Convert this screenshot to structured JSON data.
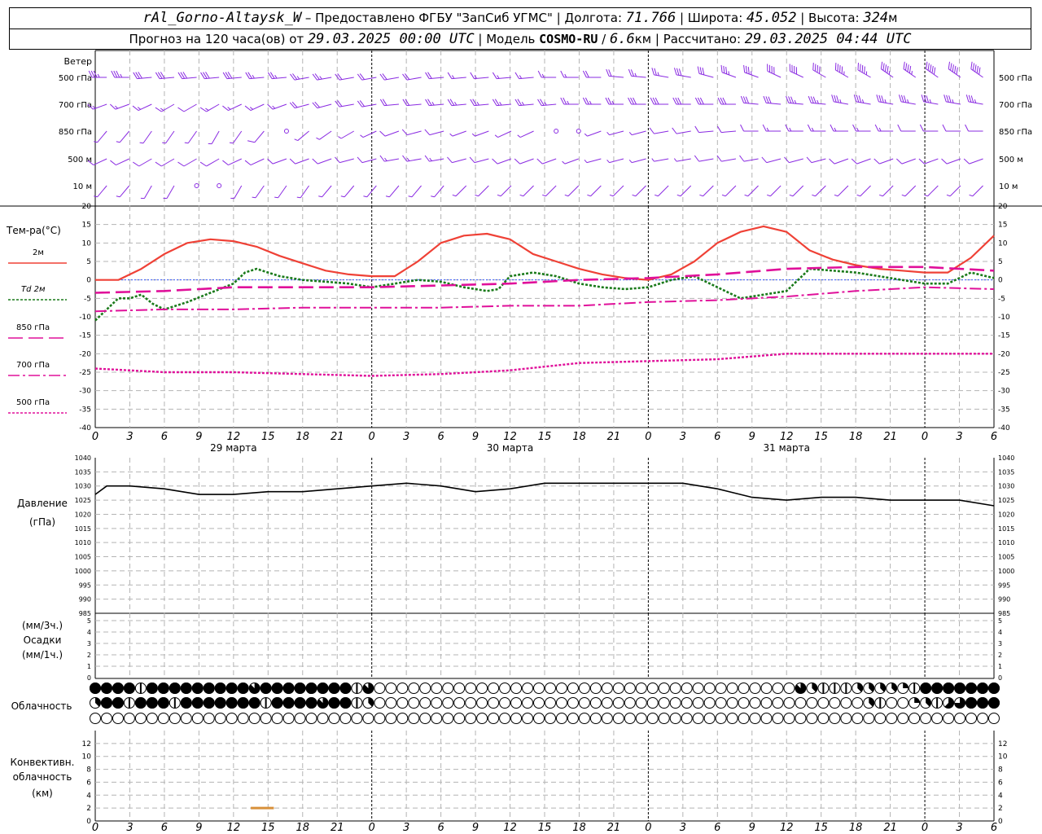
{
  "header": {
    "station": "rAl_Gorno-Altaysk_W",
    "provider": " – Предоставлено ФГБУ \"ЗапСиб УГМС\" | Долгота: ",
    "lon": "71.766",
    "lat_label": " | Широта: ",
    "lat": "45.052",
    "alt_label": " | Высота: ",
    "alt": "324",
    "alt_unit": "м",
    "line2_a": "Прогноз на 120 часа(ов) от ",
    "run": "29.03.2025 00:00 UTC",
    "line2_b": " | Модель ",
    "model": "COSMO-RU",
    "model_sep": " / ",
    "res": "6.6",
    "res_unit": "км",
    "line2_c": " | Рассчитано: ",
    "calc": "29.03.2025 04:44 UTC"
  },
  "labels": {
    "wind_title": "Ветер",
    "wind_levels": [
      "500 гПа",
      "700 гПа",
      "850 гПа",
      "500 м",
      "10 м"
    ],
    "temp_title": "Тем-ра(°С)",
    "temp_legend": [
      "2м",
      "Td 2м",
      "850 гПа",
      "700 гПа",
      "500 гПа"
    ],
    "pressure_title": "Давление",
    "pressure_unit": "(гПа)",
    "precip_top": "(мм/3ч.)",
    "precip_title": "Осадки",
    "precip_bottom": "(мм/1ч.)",
    "cloud_title": "Облачность",
    "conv_1": "Конвективн.",
    "conv_2": "облачность",
    "conv_3": "(км)"
  },
  "colors": {
    "wind": "#8a2be2",
    "t2m": "#ef4136",
    "td": "#1a7a1a",
    "t850": "#e0109a",
    "zero_line": "#3355ff",
    "pressure": "#000000",
    "conv": "#d8903a"
  },
  "chart_data": {
    "type": "line",
    "x_ticks": [
      "0",
      "3",
      "6",
      "9",
      "12",
      "15",
      "18",
      "21",
      "0",
      "3",
      "6",
      "9",
      "12",
      "15",
      "18",
      "21",
      "0",
      "3",
      "6",
      "9",
      "12",
      "15",
      "18",
      "21",
      "0",
      "3",
      "6"
    ],
    "dates": [
      "29 марта",
      "30 марта",
      "31 марта"
    ],
    "x_hours_range": [
      0,
      78
    ],
    "temperature": {
      "ylim": [
        -40,
        20
      ],
      "yticks": [
        20,
        15,
        10,
        5,
        0,
        -5,
        -10,
        -15,
        -20,
        -25,
        -30,
        -35,
        -40
      ],
      "series": [
        {
          "name": "2м",
          "x": [
            0,
            2,
            4,
            6,
            8,
            10,
            12,
            14,
            16,
            18,
            20,
            22,
            24,
            26,
            28,
            30,
            32,
            34,
            36,
            38,
            40,
            42,
            44,
            46,
            48,
            50,
            52,
            54,
            56,
            58,
            60,
            62,
            64,
            66,
            68,
            70,
            72,
            74,
            76,
            78
          ],
          "y": [
            0,
            0,
            3,
            7,
            10,
            11,
            10.5,
            9,
            6.5,
            4.5,
            2.5,
            1.5,
            1,
            1,
            5,
            10,
            12,
            12.5,
            11,
            7,
            5,
            3,
            1.5,
            0.5,
            0,
            1.5,
            5,
            10,
            13,
            14.5,
            13,
            8,
            5.5,
            4,
            3,
            2.5,
            2,
            2,
            6,
            12
          ]
        },
        {
          "name": "Td 2м",
          "x": [
            0,
            2,
            3,
            4,
            5,
            6,
            8,
            10,
            12,
            13,
            14,
            16,
            18,
            20,
            22,
            24,
            26,
            28,
            30,
            32,
            34,
            35,
            36,
            38,
            40,
            42,
            44,
            46,
            48,
            50,
            52,
            54,
            56,
            58,
            60,
            62,
            64,
            66,
            68,
            70,
            72,
            74,
            76,
            78
          ],
          "y": [
            -11,
            -5,
            -5,
            -4,
            -6.5,
            -8,
            -6,
            -3.5,
            -1,
            2,
            3,
            1,
            0,
            -0.5,
            -1,
            -2,
            -1,
            0,
            -0.5,
            -2,
            -3,
            -2.5,
            1,
            2,
            1,
            -1,
            -2,
            -2.5,
            -2,
            0,
            1,
            -2,
            -5,
            -4,
            -3,
            3,
            2.5,
            2,
            1,
            0,
            -1,
            -1,
            2,
            0.5
          ]
        },
        {
          "name": "850 гПа",
          "x": [
            0,
            6,
            12,
            18,
            24,
            30,
            36,
            42,
            48,
            54,
            60,
            66,
            72,
            78
          ],
          "y": [
            -3.5,
            -3,
            -2,
            -2,
            -2,
            -1.5,
            -1,
            0,
            0.5,
            1.5,
            3,
            3.5,
            3.5,
            2.5
          ]
        },
        {
          "name": "700 гПа",
          "x": [
            0,
            6,
            12,
            18,
            24,
            30,
            36,
            42,
            48,
            54,
            60,
            66,
            72,
            78
          ],
          "y": [
            -8.5,
            -8,
            -8,
            -7.5,
            -7.5,
            -7.5,
            -7,
            -7,
            -6,
            -5.5,
            -4.5,
            -3,
            -2,
            -2.5
          ]
        },
        {
          "name": "500 гПа",
          "x": [
            0,
            6,
            12,
            18,
            24,
            30,
            36,
            42,
            48,
            54,
            60,
            66,
            72,
            78
          ],
          "y": [
            -24,
            -25,
            -25,
            -25.5,
            -26,
            -25.5,
            -24.5,
            -22.5,
            -22,
            -21.5,
            -20,
            -20,
            -20,
            -20
          ]
        }
      ]
    },
    "pressure": {
      "ylim": [
        985,
        1040
      ],
      "yticks": [
        1040,
        1035,
        1030,
        1025,
        1020,
        1015,
        1010,
        1005,
        1000,
        995,
        990,
        985
      ],
      "x": [
        0,
        1,
        3,
        6,
        9,
        12,
        15,
        18,
        21,
        24,
        27,
        30,
        33,
        36,
        39,
        42,
        45,
        48,
        51,
        54,
        57,
        60,
        63,
        66,
        69,
        72,
        75,
        78
      ],
      "y": [
        1027,
        1030,
        1030,
        1029,
        1027,
        1027,
        1028,
        1028,
        1029,
        1030,
        1031,
        1030,
        1028,
        1029,
        1031,
        1031,
        1031,
        1031,
        1031,
        1029,
        1026,
        1025,
        1026,
        1026,
        1025,
        1025,
        1025,
        1023
      ]
    },
    "precipitation": {
      "yticks": [
        5,
        4,
        3,
        2,
        1,
        0
      ],
      "values": []
    },
    "cloudiness": {
      "rows": 3,
      "levels_0_to_8_per_row": [
        [
          8,
          8,
          8,
          8,
          4,
          8,
          8,
          8,
          8,
          8,
          8,
          8,
          8,
          8,
          7,
          8,
          8,
          8,
          8,
          8,
          8,
          8,
          8,
          4,
          7,
          0,
          0,
          0,
          0,
          0,
          0,
          0,
          0,
          0,
          0,
          0,
          0,
          0,
          0,
          0,
          0,
          0,
          0,
          0,
          0,
          0,
          0,
          0,
          0,
          0,
          0,
          0,
          0,
          0,
          0,
          0,
          0,
          0,
          0,
          0,
          0,
          0,
          7,
          3,
          4,
          4,
          4,
          3,
          3,
          3,
          3,
          2,
          4,
          8,
          8,
          8,
          8,
          8,
          8,
          8
        ],
        [
          3,
          8,
          8,
          4,
          8,
          8,
          8,
          4,
          8,
          8,
          8,
          8,
          8,
          8,
          8,
          4,
          8,
          8,
          8,
          8,
          7,
          8,
          8,
          4,
          3,
          0,
          0,
          0,
          0,
          0,
          0,
          0,
          0,
          0,
          0,
          0,
          0,
          0,
          0,
          0,
          0,
          0,
          0,
          0,
          0,
          0,
          0,
          0,
          0,
          0,
          0,
          0,
          0,
          0,
          0,
          0,
          0,
          0,
          0,
          0,
          0,
          0,
          0,
          0,
          0,
          0,
          0,
          0,
          3,
          4,
          0,
          0,
          2,
          3,
          4,
          5,
          6,
          8,
          8,
          8
        ]
      ]
    },
    "convective_clouds": {
      "ylim": [
        0,
        14
      ],
      "yticks": [
        12,
        10,
        8,
        6,
        4,
        2,
        0
      ],
      "segments": [
        {
          "x_from": 13.5,
          "x_to": 15.5,
          "top_km": 2
        }
      ]
    },
    "wind": {
      "levels": [
        "500 гПа",
        "700 гПа",
        "850 гПа",
        "500 м",
        "10 м"
      ],
      "speed_ms": [
        [
          14,
          14,
          13,
          13,
          12,
          12,
          12,
          11,
          10,
          10,
          10,
          9,
          9,
          9,
          8,
          8,
          7,
          6,
          6,
          6,
          7,
          7,
          8,
          9,
          10,
          11,
          12,
          13,
          14,
          15,
          16,
          17,
          17,
          18,
          18,
          19,
          19,
          20,
          20,
          21
        ],
        [
          7,
          7,
          6,
          6,
          5,
          6,
          6,
          7,
          7,
          8,
          8,
          9,
          9,
          9,
          9,
          10,
          10,
          10,
          10,
          10,
          10,
          10,
          11,
          11,
          12,
          12,
          13,
          13,
          13,
          13,
          13,
          14,
          14,
          14,
          14,
          15,
          15,
          15,
          15,
          14
        ],
        [
          3,
          3,
          2,
          3,
          3,
          3,
          3,
          4,
          0,
          3,
          3,
          3,
          3,
          4,
          4,
          4,
          3,
          3,
          3,
          3,
          0,
          0,
          3,
          3,
          3,
          4,
          4,
          4,
          5,
          5,
          6,
          6,
          7,
          6,
          6,
          6,
          5,
          5,
          4,
          4
        ],
        [
          4,
          4,
          4,
          5,
          5,
          5,
          4,
          4,
          4,
          4,
          5,
          5,
          5,
          6,
          6,
          6,
          5,
          5,
          4,
          4,
          4,
          3,
          3,
          3,
          3,
          3,
          3,
          4,
          4,
          4,
          4,
          4,
          4,
          4,
          4,
          4,
          4,
          4,
          4,
          4
        ],
        [
          2,
          2,
          2,
          2,
          0,
          0,
          2,
          2,
          2,
          2,
          2,
          3,
          3,
          2,
          2,
          2,
          2,
          2,
          2,
          2,
          2,
          2,
          2,
          2,
          2,
          2,
          2,
          2,
          2,
          2,
          2,
          2,
          2,
          2,
          2,
          2,
          2,
          2,
          2,
          2
        ]
      ],
      "dir_deg": [
        [
          270,
          270,
          265,
          265,
          265,
          265,
          265,
          265,
          265,
          260,
          260,
          260,
          260,
          260,
          260,
          265,
          265,
          265,
          265,
          265,
          270,
          270,
          270,
          275,
          275,
          280,
          280,
          285,
          290,
          290,
          295,
          295,
          300,
          300,
          300,
          305,
          305,
          305,
          305,
          305
        ],
        [
          250,
          250,
          245,
          240,
          240,
          240,
          245,
          245,
          250,
          255,
          255,
          260,
          260,
          265,
          265,
          265,
          265,
          265,
          265,
          265,
          265,
          270,
          270,
          270,
          270,
          270,
          270,
          270,
          270,
          275,
          275,
          275,
          275,
          280,
          280,
          280,
          280,
          280,
          280,
          280
        ],
        [
          220,
          220,
          215,
          215,
          215,
          210,
          215,
          220,
          0,
          230,
          235,
          240,
          245,
          250,
          255,
          255,
          250,
          250,
          245,
          245,
          0,
          0,
          250,
          255,
          255,
          260,
          260,
          265,
          265,
          270,
          270,
          270,
          270,
          270,
          270,
          270,
          270,
          270,
          270,
          270
        ],
        [
          245,
          245,
          240,
          240,
          240,
          240,
          245,
          245,
          250,
          250,
          250,
          255,
          255,
          260,
          260,
          260,
          255,
          255,
          250,
          250,
          250,
          250,
          255,
          255,
          255,
          260,
          260,
          260,
          260,
          260,
          255,
          255,
          255,
          250,
          250,
          250,
          250,
          250,
          250,
          250
        ],
        [
          220,
          220,
          210,
          210,
          0,
          0,
          210,
          215,
          215,
          215,
          220,
          220,
          220,
          220,
          220,
          220,
          225,
          225,
          225,
          225,
          225,
          225,
          225,
          225,
          225,
          225,
          225,
          225,
          225,
          225,
          225,
          225,
          225,
          225,
          225,
          225,
          225,
          225,
          225,
          225
        ]
      ]
    }
  }
}
